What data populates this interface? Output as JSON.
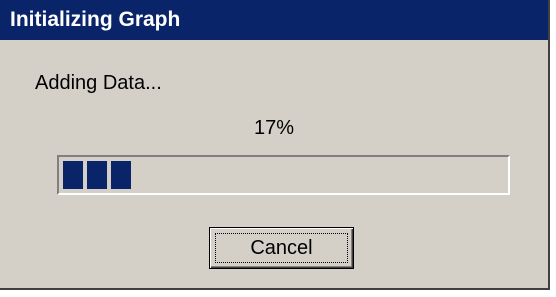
{
  "window": {
    "title": "Initializing Graph"
  },
  "status": {
    "message": "Adding Data...",
    "percent_text": "17%",
    "progress_fraction": 0.17
  },
  "buttons": {
    "cancel_label": "Cancel"
  },
  "colors": {
    "titlebar_bg": "#0a246a",
    "dialog_bg": "#d4d0c8",
    "progress_fill": "#0a246a"
  }
}
